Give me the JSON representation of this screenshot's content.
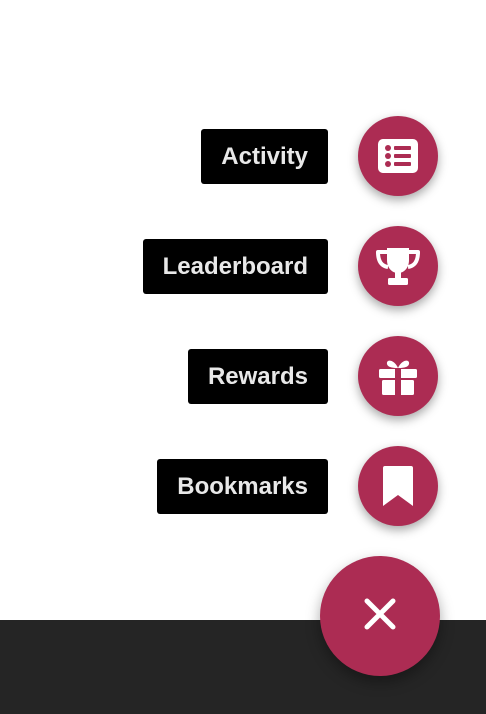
{
  "colors": {
    "fab_background": "#ac2c53",
    "label_background": "#000000",
    "label_text": "#e8e8e8",
    "bottom_bar": "#252525",
    "page_background": "#ffffff"
  },
  "speed_dial": {
    "actions": [
      {
        "label": "Activity",
        "icon": "list-alt-icon"
      },
      {
        "label": "Leaderboard",
        "icon": "trophy-icon"
      },
      {
        "label": "Rewards",
        "icon": "gift-icon"
      },
      {
        "label": "Bookmarks",
        "icon": "bookmark-icon"
      }
    ],
    "toggle_icon": "close-icon"
  }
}
